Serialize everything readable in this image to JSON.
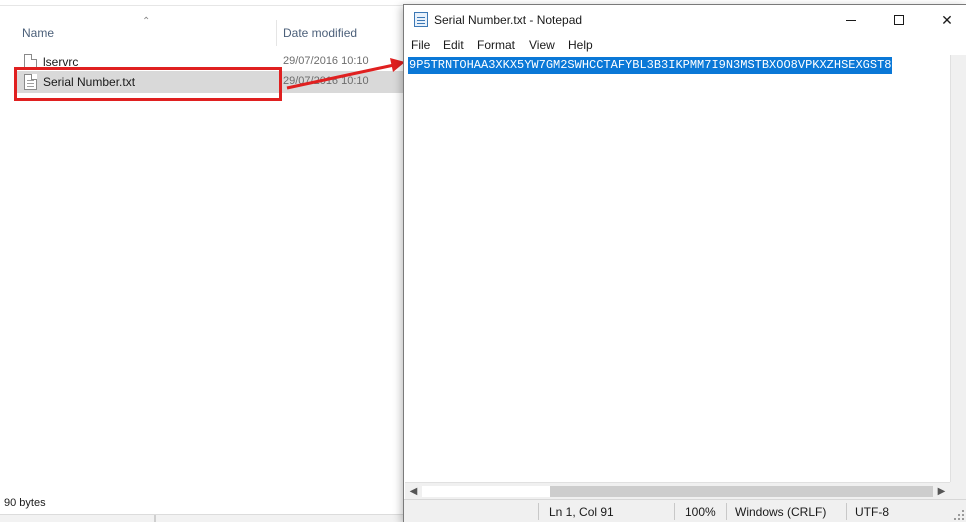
{
  "explorer": {
    "columns": {
      "name": "Name",
      "date_modified": "Date modified"
    },
    "files": [
      {
        "name": "lservrc",
        "date": "29/07/2016 10:10"
      },
      {
        "name": "Serial Number.txt",
        "date": "29/07/2016 10:10"
      }
    ],
    "status_count": "90 bytes"
  },
  "notepad": {
    "title": "Serial Number.txt - Notepad",
    "menu": {
      "file": "File",
      "edit": "Edit",
      "format": "Format",
      "view": "View",
      "help": "Help"
    },
    "content": "9P5TRNTOHAA3XKX5YW7GM2SWHCCTAFYBL3B3IKPMM7I9N3MSTBXOO8VPKXZHSEXGST8",
    "status": {
      "position": "Ln 1, Col 91",
      "zoom": "100%",
      "line_ending": "Windows (CRLF)",
      "encoding": "UTF-8"
    }
  },
  "colors": {
    "selection": "#0a78d7",
    "annotation": "#e02020",
    "row_selected": "#d9d9d9"
  }
}
